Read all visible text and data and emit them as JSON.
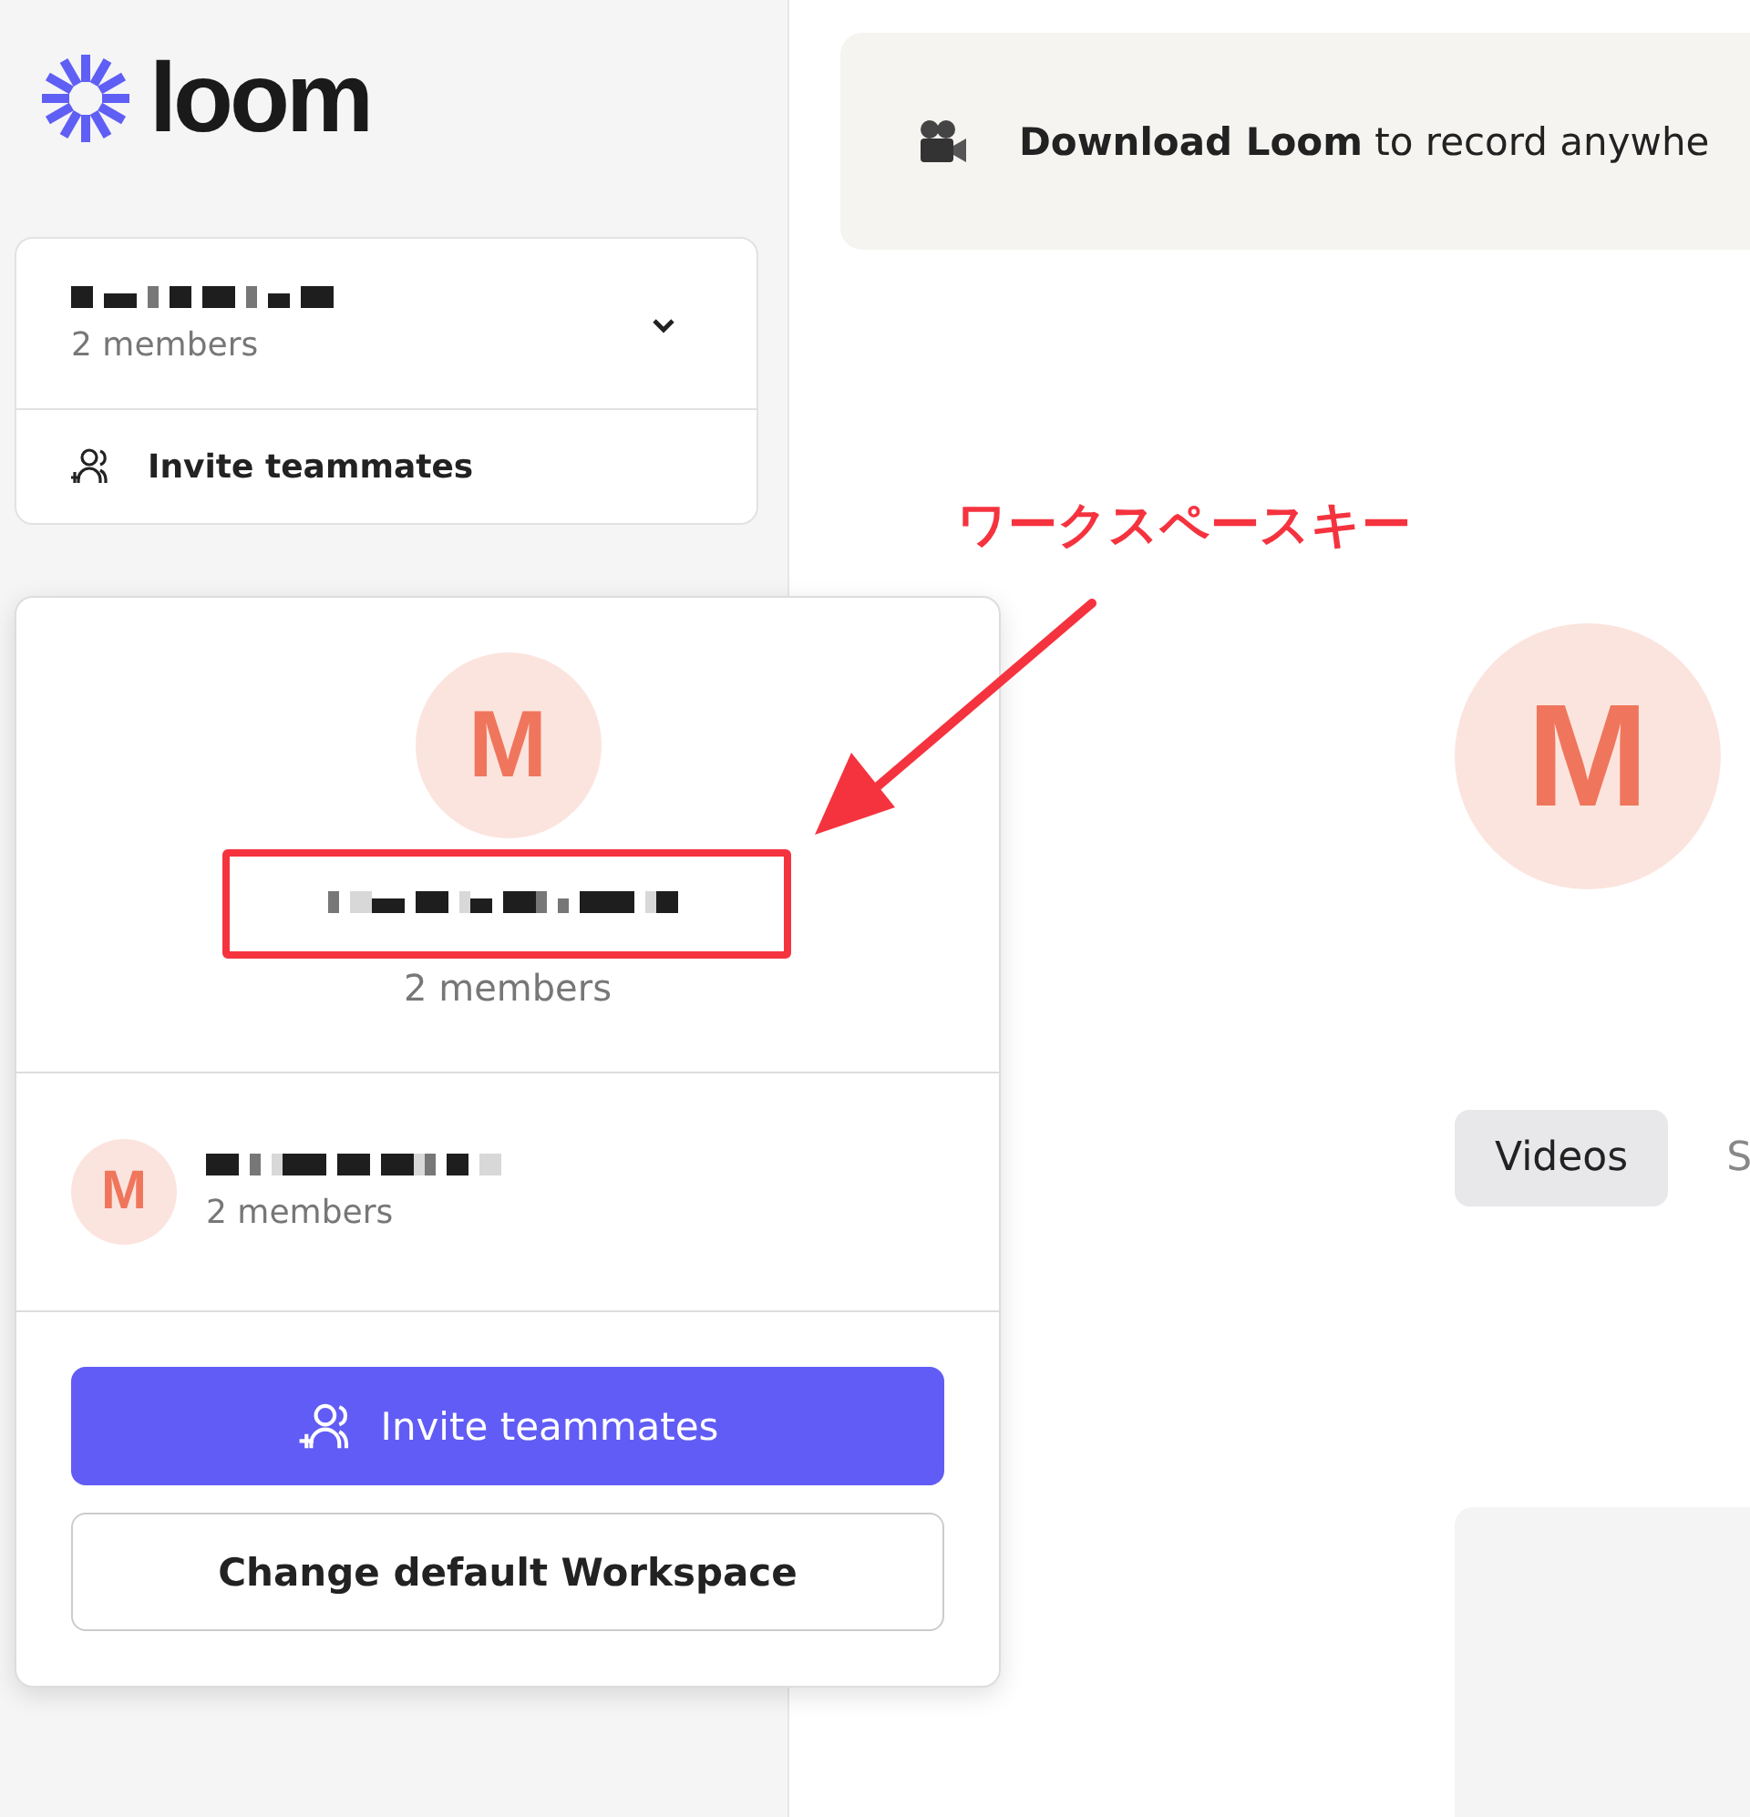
{
  "logo": {
    "wordmark": "loom"
  },
  "workspace_selector": {
    "members": "2 members",
    "expanded": true,
    "invite": "Invite teammates"
  },
  "banner": {
    "text": "**Download Loom** to record anywhe"
  },
  "popover": {
    "current": {
      "initial": "M",
      "members": "2 members"
    },
    "others": [
      {
        "initial": "M",
        "members": "2 members"
      }
    ],
    "primary_button": "Invite teammates",
    "secondary_button": "Change default Workspace"
  },
  "main": {
    "avatar_initial": "M",
    "tabs": [
      {
        "label": "Videos",
        "selected": true
      },
      {
        "label": "S",
        "selected": false
      }
    ]
  },
  "annotation": {
    "label": "ワークスペースキー"
  }
}
